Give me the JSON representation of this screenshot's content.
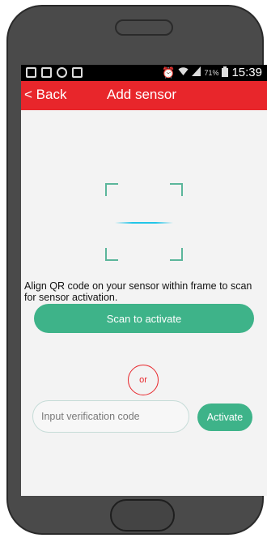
{
  "status_bar": {
    "battery_pct": "71%",
    "time": "15:39",
    "icons": [
      "notification-icon",
      "gallery-icon",
      "sync-icon",
      "bag-icon",
      "alarm-icon",
      "wifi-icon",
      "signal-icon",
      "battery-icon"
    ]
  },
  "nav": {
    "back_label": "< Back",
    "title": "Add sensor",
    "color": "#e8262b"
  },
  "scanner": {
    "frame_color": "#5bb69b",
    "line_color": "#22c5e8"
  },
  "instruction": "Align QR code on your sensor within frame to scan for sensor activation.",
  "scan_button": {
    "label": "Scan to activate",
    "color": "#3eb389"
  },
  "separator": {
    "label": "or"
  },
  "verification": {
    "placeholder": "Input verification code",
    "value": "",
    "button_label": "Activate"
  }
}
